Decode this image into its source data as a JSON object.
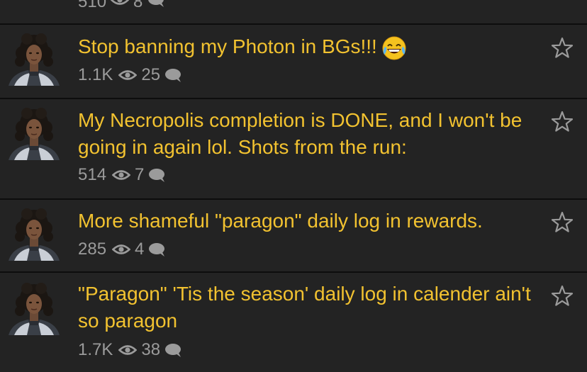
{
  "colors": {
    "background": "#232323",
    "separator": "#0d0d0d",
    "title": "#f2c230",
    "meta": "#9b9b9b"
  },
  "partial_thread": {
    "views": "510",
    "comments": "8"
  },
  "threads": [
    {
      "title": "Stop banning my Photon in BGs!!!",
      "title_emoji": "face-with-tears-of-joy",
      "views": "1.1K",
      "comments": "25"
    },
    {
      "title": "My Necropolis completion is DONE, and I won't be going in again lol. Shots from the run:",
      "views": "514",
      "comments": "7"
    },
    {
      "title": "More shameful \"paragon\" daily log in rewards.",
      "views": "285",
      "comments": "4"
    },
    {
      "title": "\"Paragon\" 'Tis the season' daily log in calender ain't so paragon",
      "views": "1.7K",
      "comments": "38"
    }
  ],
  "icons": {
    "views": "eye-icon",
    "comments": "speech-bubble-icon",
    "favorite": "star-outline-icon",
    "avatar": "user-avatar"
  }
}
